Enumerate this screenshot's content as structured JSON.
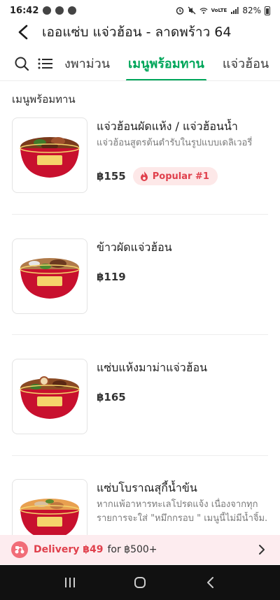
{
  "status_bar": {
    "time": "16:42",
    "battery": "82%",
    "network": "VoLTE"
  },
  "header": {
    "title": "เออแซ่บ แจ่วฮ้อน - ลาดพร้าว 64"
  },
  "tabs": [
    {
      "label": "งพาม่วน"
    },
    {
      "label": "เมนูพร้อมทาน",
      "active": true
    },
    {
      "label": "แจ่วฮ้อน"
    }
  ],
  "section": {
    "title": "เมนูพร้อมทาน"
  },
  "items": [
    {
      "name": "แจ่วฮ้อนผัดแห้ง / แจ่วฮ้อนน้ำ",
      "description": "แจ่วฮ้อนสูตรต้นตำรับในรูปแบบเดลิเวอรี่",
      "price": "฿155",
      "badge": "Popular #1"
    },
    {
      "name": "ข้าวผัดแจ่วฮ้อน",
      "description": "",
      "price": "฿119"
    },
    {
      "name": "แซ่บแห้งมาม่าแจ่วฮ้อน",
      "description": "",
      "price": "฿165"
    },
    {
      "name": "แซ่บโบราณสุกี้น้ำข้น",
      "description_line1": "หากแพ้อาหารทะเลโปรดแจ้ง เนื่องจากทุก",
      "description_line2": "รายการจะใส่ \"หมึกกรอบ \" เมนูนี้ไม่มีน้ำจิ้ม..."
    }
  ],
  "delivery": {
    "main": "Delivery ฿49",
    "sub": "for ฿500+"
  },
  "colors": {
    "accent_green": "#00a65a",
    "badge_red": "#e0404c",
    "banner_pink": "#fdecef"
  }
}
